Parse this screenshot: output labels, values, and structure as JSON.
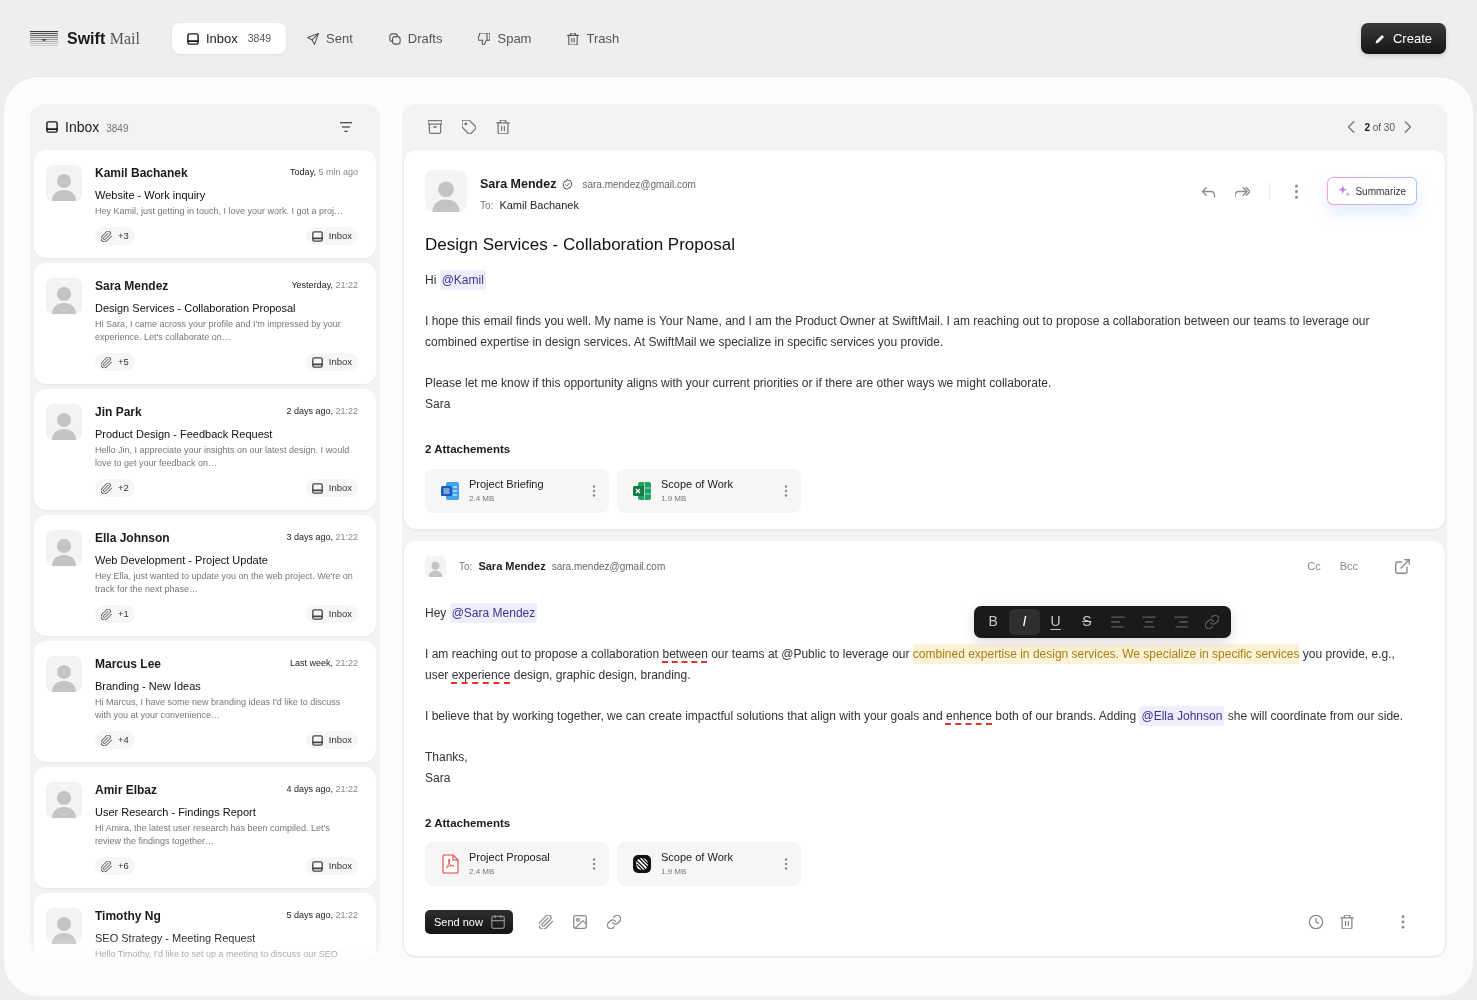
{
  "topbar": {
    "logo": {
      "word": "Swift",
      "suffix": "Mail"
    },
    "tabs": [
      {
        "label": "Inbox",
        "count": "3849",
        "selected": true
      },
      {
        "label": "Sent",
        "selected": false
      },
      {
        "label": "Drafts",
        "selected": false
      },
      {
        "label": "Spam",
        "selected": false
      },
      {
        "label": "Trash",
        "selected": false
      }
    ],
    "create_button": "Create"
  },
  "inbox_list": {
    "title": "Inbox",
    "count": "3849",
    "messages": [
      {
        "sender": "Kamil Bachanek",
        "day": "Today,",
        "time": "5 min ago",
        "subject": "Website - Work inquiry",
        "preview": "Hey Kamil, just getting in touch, I love your work. I got a proj…",
        "attachments": "+3",
        "folder": "Inbox"
      },
      {
        "sender": "Sara Mendez",
        "day": "Yesterday,",
        "time": "21:22",
        "subject": "Design Services - Collaboration Proposal",
        "preview": "Hi Sara, I came across your profile and I'm impressed by your experience. Let's collaborate on…",
        "attachments": "+5",
        "folder": "Inbox"
      },
      {
        "sender": "Jin Park",
        "day": "2 days ago,",
        "time": "21:22",
        "subject": "Product Design - Feedback Request",
        "preview": "Hello Jin, I appreciate your insights on our latest design. I would love to get your feedback on…",
        "attachments": "+2",
        "folder": "Inbox"
      },
      {
        "sender": "Ella Johnson",
        "day": "3 days ago,",
        "time": "21:22",
        "subject": "Web Development - Project Update",
        "preview": "Hey Ella, just wanted to update you on the web project. We're on track for the next phase…",
        "attachments": "+1",
        "folder": "Inbox"
      },
      {
        "sender": "Marcus Lee",
        "day": "Last week,",
        "time": "21:22",
        "subject": "Branding - New Ideas",
        "preview": "Hi Marcus, I have some new branding ideas I'd like to discuss with you at your convenience…",
        "attachments": "+4",
        "folder": "Inbox"
      },
      {
        "sender": "Amir Elbaz",
        "day": "4 days ago,",
        "time": "21:22",
        "subject": "User Research - Findings Report",
        "preview": "Hi Amira, the latest user research has been compiled. Let's review the findings together…",
        "attachments": "+6",
        "folder": "Inbox"
      },
      {
        "sender": "Timothy Ng",
        "day": "5 days ago,",
        "time": "21:22",
        "subject": "SEO Strategy - Meeting Request",
        "preview": "Hello Timothy, I'd like to set up a meeting to discuss our SEO"
      }
    ]
  },
  "reader": {
    "pager": "**2** of 30",
    "message": {
      "sender": "Sara Mendez",
      "verified": true,
      "email": "sara.mendez@gmail.com",
      "to_label": "To:",
      "to": "Kamil Bachanek",
      "summarize_button": "Summarize",
      "subject": "Design Services - Collaboration Proposal",
      "body": [
        {
          "lines": [
            [
              {
                "text": "Hi ",
                "kind": "text"
              },
              {
                "text": "@Kamil",
                "kind": "mention"
              }
            ]
          ]
        },
        {
          "lines": [
            [
              {
                "text": "I hope this email finds you well. My name is Your Name, and I am the Product Owner at SwiftMail. I am reaching out to propose a collaboration between our teams to leverage our combined expertise in design services. At SwiftMail we specialize in specific services you provide.",
                "kind": "text"
              }
            ]
          ]
        },
        {
          "lines": [
            [
              {
                "text": "Please let me know if this opportunity aligns with your current priorities or if there are other ways we might collaborate.",
                "kind": "text"
              }
            ],
            [
              {
                "text": "Sara",
                "kind": "text"
              }
            ]
          ]
        }
      ],
      "attachments_title": "2 Attachements",
      "attachments": [
        {
          "name": "Project Briefing",
          "size": "2.4 MB",
          "kind": "doc"
        },
        {
          "name": "Scope of Work",
          "size": "1.9 MB",
          "kind": "sheet"
        }
      ]
    },
    "reply": {
      "to_label": "To:",
      "to": "Sara Mendez",
      "email": "sara.mendez@gmail.com",
      "cc": "Cc",
      "bcc": "Bcc",
      "format_toolbar": [
        {
          "kind": "bold",
          "label": "B",
          "selected": false
        },
        {
          "kind": "italic",
          "label": "I",
          "selected": true
        },
        {
          "kind": "underline",
          "label": "U",
          "selected": false
        },
        {
          "kind": "strike",
          "label": "S",
          "selected": false
        },
        {
          "kind": "left",
          "selected": false
        },
        {
          "kind": "center",
          "selected": false
        },
        {
          "kind": "right",
          "selected": false
        },
        {
          "kind": "link",
          "selected": false
        }
      ],
      "body": [
        {
          "lines": [
            [
              {
                "text": "Hey ",
                "kind": "text"
              },
              {
                "text": "@Sara Mendez",
                "kind": "mention"
              }
            ]
          ]
        },
        {
          "lines": [
            [
              {
                "text": "I am reaching out to propose a collaboration ",
                "kind": "text"
              },
              {
                "text": "between",
                "kind": "misspelled"
              },
              {
                "text": " our teams at @Public to leverage our ",
                "kind": "text"
              },
              {
                "text": "combined expertise in design services. We specialize in specific services",
                "kind": "highlight"
              },
              {
                "text": " you provide, e.g., user ",
                "kind": "text"
              },
              {
                "text": "experience",
                "kind": "misspelled"
              },
              {
                "text": " design, graphic design, branding.",
                "kind": "text"
              }
            ]
          ]
        },
        {
          "lines": [
            [
              {
                "text": "I believe that by working together, we can create impactful solutions that align with your goals and ",
                "kind": "text"
              },
              {
                "text": "enhence",
                "kind": "misspelled"
              },
              {
                "text": " both of our brands. Adding ",
                "kind": "text"
              },
              {
                "text": "@Ella Johnson",
                "kind": "mention"
              },
              {
                "text": " she will coordinate from our side.",
                "kind": "text"
              }
            ]
          ]
        },
        {
          "lines": [
            [
              {
                "text": "Thanks,",
                "kind": "text"
              }
            ],
            [
              {
                "text": "Sara",
                "kind": "text"
              }
            ]
          ]
        }
      ],
      "attachments_title": "2 Attachements",
      "attachments": [
        {
          "name": "Project Proposal",
          "size": "2.4 MB",
          "kind": "pdf"
        },
        {
          "name": "Scope of Work",
          "size": "1.9 MB",
          "kind": "design"
        }
      ],
      "send_button": "Send now"
    }
  }
}
